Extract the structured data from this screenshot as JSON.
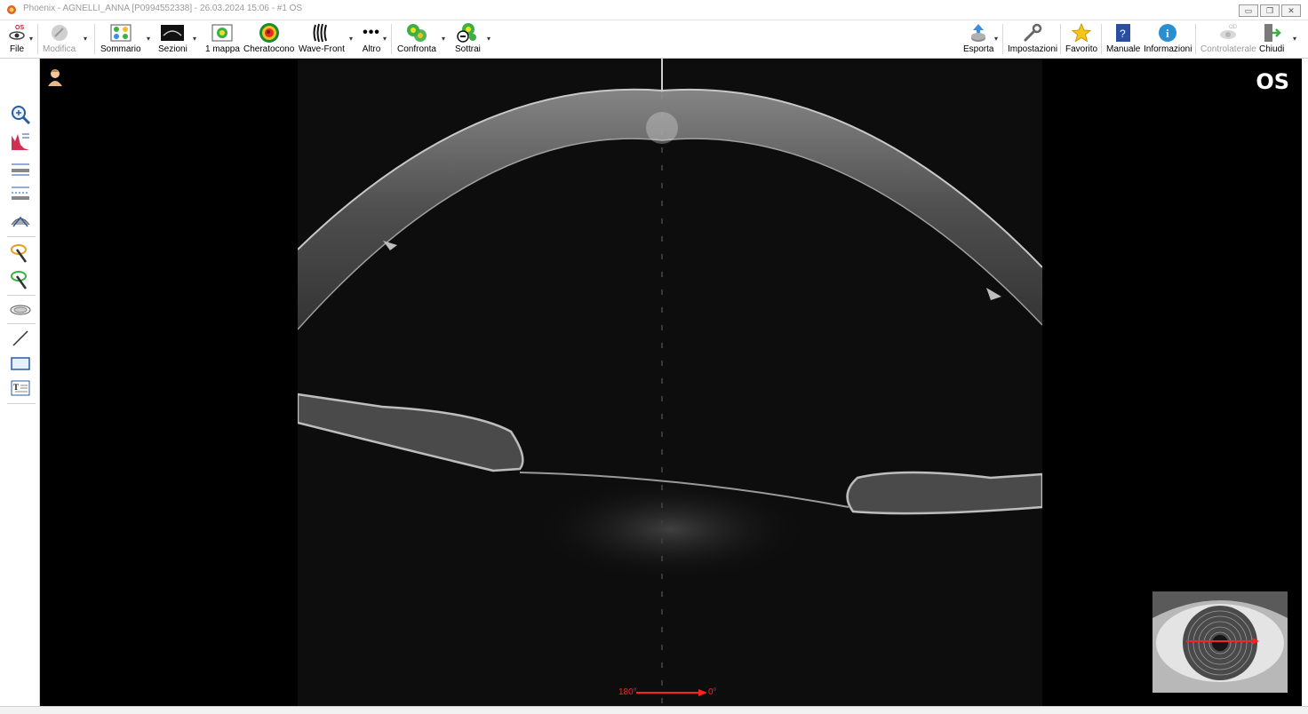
{
  "window": {
    "title": "Phoenix - AGNELLI_ANNA [P0994552338] - 26.03.2024 15:06 - #1 OS",
    "buttons": [
      "minimize-icon",
      "restore-icon",
      "close-icon"
    ]
  },
  "toolbar": {
    "file": "File",
    "modifica": "Modifica",
    "sommario": "Sommario",
    "sezioni": "Sezioni",
    "mappa": "1 mappa",
    "cheratocono": "Cheratocono",
    "wavefront": "Wave-Front",
    "altro": "Altro",
    "confronta": "Confronta",
    "sottrai": "Sottrai",
    "esporta": "Esporta",
    "impostazioni": "Impostazioni",
    "favorito": "Favorito",
    "manuale": "Manuale",
    "informazioni": "Informazioni",
    "controlaterale": "Controlaterale",
    "chiudi": "Chiudi"
  },
  "sidebar_tools": [
    "zoom-icon",
    "histogram-icon",
    "distance-measure-icon",
    "thickness-measure-icon",
    "angle-measure-icon",
    "magic-wand-yellow-icon",
    "magic-wand-green-icon",
    "lens-icon",
    "line-tool-icon",
    "rectangle-tool-icon",
    "text-tool-icon"
  ],
  "viewer": {
    "eye": "OS",
    "angle_left": "180°",
    "angle_right": "0°",
    "marker_color": "#ff2020"
  }
}
